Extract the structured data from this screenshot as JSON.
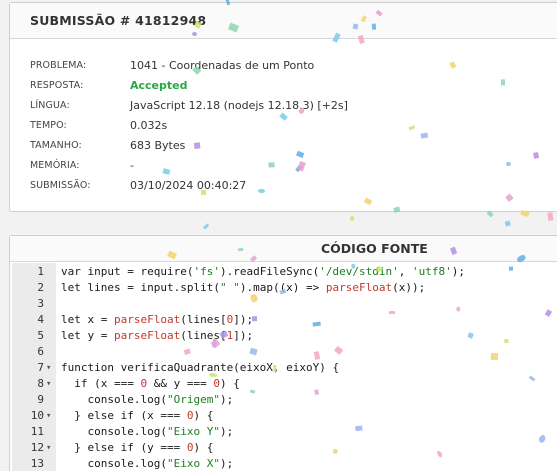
{
  "submission": {
    "title": "SUBMISSÃO # 41812948",
    "rows": [
      {
        "label": "PROBLEMA:",
        "value": "1041 - Coordenadas de um Ponto"
      },
      {
        "label": "RESPOSTA:",
        "value": "Accepted"
      },
      {
        "label": "LÍNGUA:",
        "value": "JavaScript 12.18 (nodejs 12.18.3) [+2s]"
      },
      {
        "label": "TEMPO:",
        "value": "0.032s"
      },
      {
        "label": "TAMANHO:",
        "value": "683 Bytes"
      },
      {
        "label": "MEMÓRIA:",
        "value": "-"
      },
      {
        "label": "SUBMISSÃO:",
        "value": "03/10/2024 00:40:27"
      }
    ],
    "accepted_color": "#27a844"
  },
  "code": {
    "title": "CÓDIGO FONTE",
    "lines": [
      {
        "n": "1",
        "fold": "",
        "text": "var input = require('fs').readFileSync('/dev/stdin', 'utf8');"
      },
      {
        "n": "2",
        "fold": "",
        "text": "let lines = input.split(\" \").map((x) => parseFloat(x));"
      },
      {
        "n": "3",
        "fold": "",
        "text": ""
      },
      {
        "n": "4",
        "fold": "",
        "text": "let x = parseFloat(lines[0]);"
      },
      {
        "n": "5",
        "fold": "",
        "text": "let y = parseFloat(lines[1]);"
      },
      {
        "n": "6",
        "fold": "",
        "text": ""
      },
      {
        "n": "7",
        "fold": "▾",
        "text": "function verificaQuadrante(eixoX, eixoY) {"
      },
      {
        "n": "8",
        "fold": "▾",
        "text": "  if (x === 0 && y === 0) {"
      },
      {
        "n": "9",
        "fold": "",
        "text": "    console.log(\"Origem\");"
      },
      {
        "n": "10",
        "fold": "▾",
        "text": "  } else if (x === 0) {"
      },
      {
        "n": "11",
        "fold": "",
        "text": "    console.log(\"Eixo Y\");"
      },
      {
        "n": "12",
        "fold": "▾",
        "text": "  } else if (y === 0) {"
      },
      {
        "n": "13",
        "fold": "",
        "text": "    console.log(\"Eixo X\");"
      }
    ]
  }
}
